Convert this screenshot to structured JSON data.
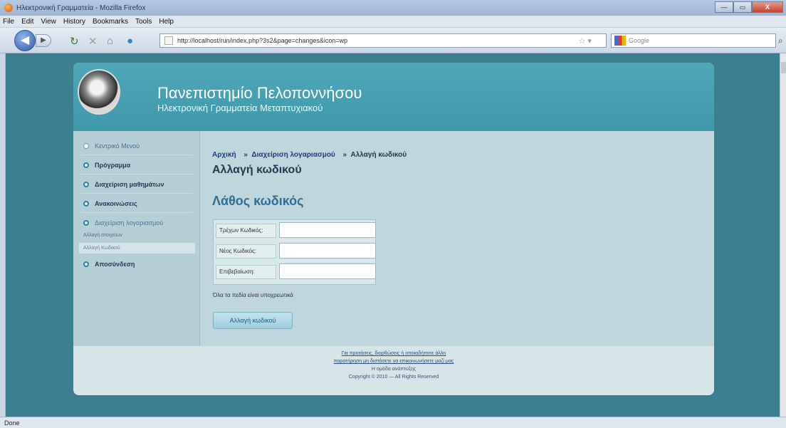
{
  "window": {
    "title": "Ηλεκτρονική Γραμματεία - Mozilla Firefox",
    "buttons": [
      "—",
      "▭",
      "X"
    ]
  },
  "menu": [
    "File",
    "Edit",
    "View",
    "History",
    "Bookmarks",
    "Tools",
    "Help"
  ],
  "nav": {
    "url": "http://localhost/run/index.php?3s2&page=changes&icon=wp",
    "search_placeholder": "Google"
  },
  "site": {
    "title": "Πανεπιστημίο Πελοποννήσου",
    "subtitle": "Ηλεκτρονική Γραμματεία Μεταπτυχιακού"
  },
  "sidebar": {
    "items": [
      {
        "label": "Κεντρικό Μενού"
      },
      {
        "label": "Πρόγραμμα"
      },
      {
        "label": "Διαχείριση μαθημάτων"
      },
      {
        "label": "Ανακοινώσεις"
      },
      {
        "label": "Διαχείριση λογαριασμού"
      },
      {
        "label": "Αποσύνδεση"
      }
    ],
    "subitems": [
      {
        "label": "Αλλαγή στοιχείων"
      },
      {
        "label": "Αλλαγή Κωδικού"
      }
    ]
  },
  "breadcrumb": {
    "home": "Αρχική",
    "account": "Διαχείριση λογαριασμού",
    "sep1": "»",
    "sep2": "»",
    "current": "Αλλαγή κωδικού"
  },
  "main": {
    "title": "Αλλαγή κωδικού",
    "error": "Λάθος κωδικός",
    "fields": [
      {
        "label": "Τρέχων Κωδικός:",
        "value": ""
      },
      {
        "label": "Νέος Κωδικός:",
        "value": ""
      },
      {
        "label": "Επιβεβαίωση:",
        "value": ""
      }
    ],
    "note": "Όλα τα πεδία είναι υποχρεωτικά",
    "submit": "Αλλαγή κωδικού"
  },
  "footer": {
    "line1": "Για προτάσεις, διορθώσεις ή οποιαδήποτε άλλη",
    "line2": "παρατήρηση μη διστάσετε να επικοινωνήσετε μαζί μας",
    "line3": "Η ομάδα ανάπτυξης",
    "line4": "Copyright © 2010 — All Rights Reserved"
  },
  "status": "Done"
}
